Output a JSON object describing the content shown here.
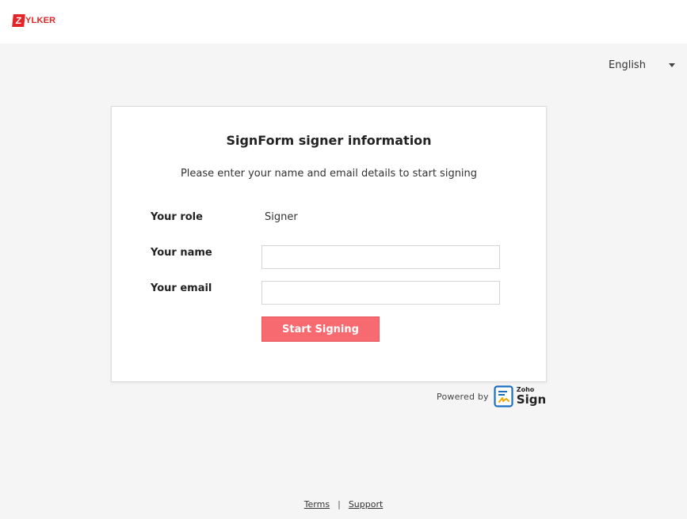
{
  "brand": {
    "logo_letter": "Z",
    "logo_text": "YLKER",
    "color": "#e42527"
  },
  "language": {
    "selected": "English"
  },
  "card": {
    "title": "SignForm signer information",
    "subtitle": "Please enter your name and email details to start signing",
    "role_label": "Your role",
    "role_value": "Signer",
    "name_label": "Your name",
    "name_value": "",
    "email_label": "Your email",
    "email_value": "",
    "submit_label": "Start Signing",
    "accent": "#f76a6f"
  },
  "powered_by": {
    "label": "Powered by",
    "product_small": "Zoho",
    "product_big": "Sign"
  },
  "footer": {
    "terms": "Terms",
    "separator": "|",
    "support": "Support"
  }
}
